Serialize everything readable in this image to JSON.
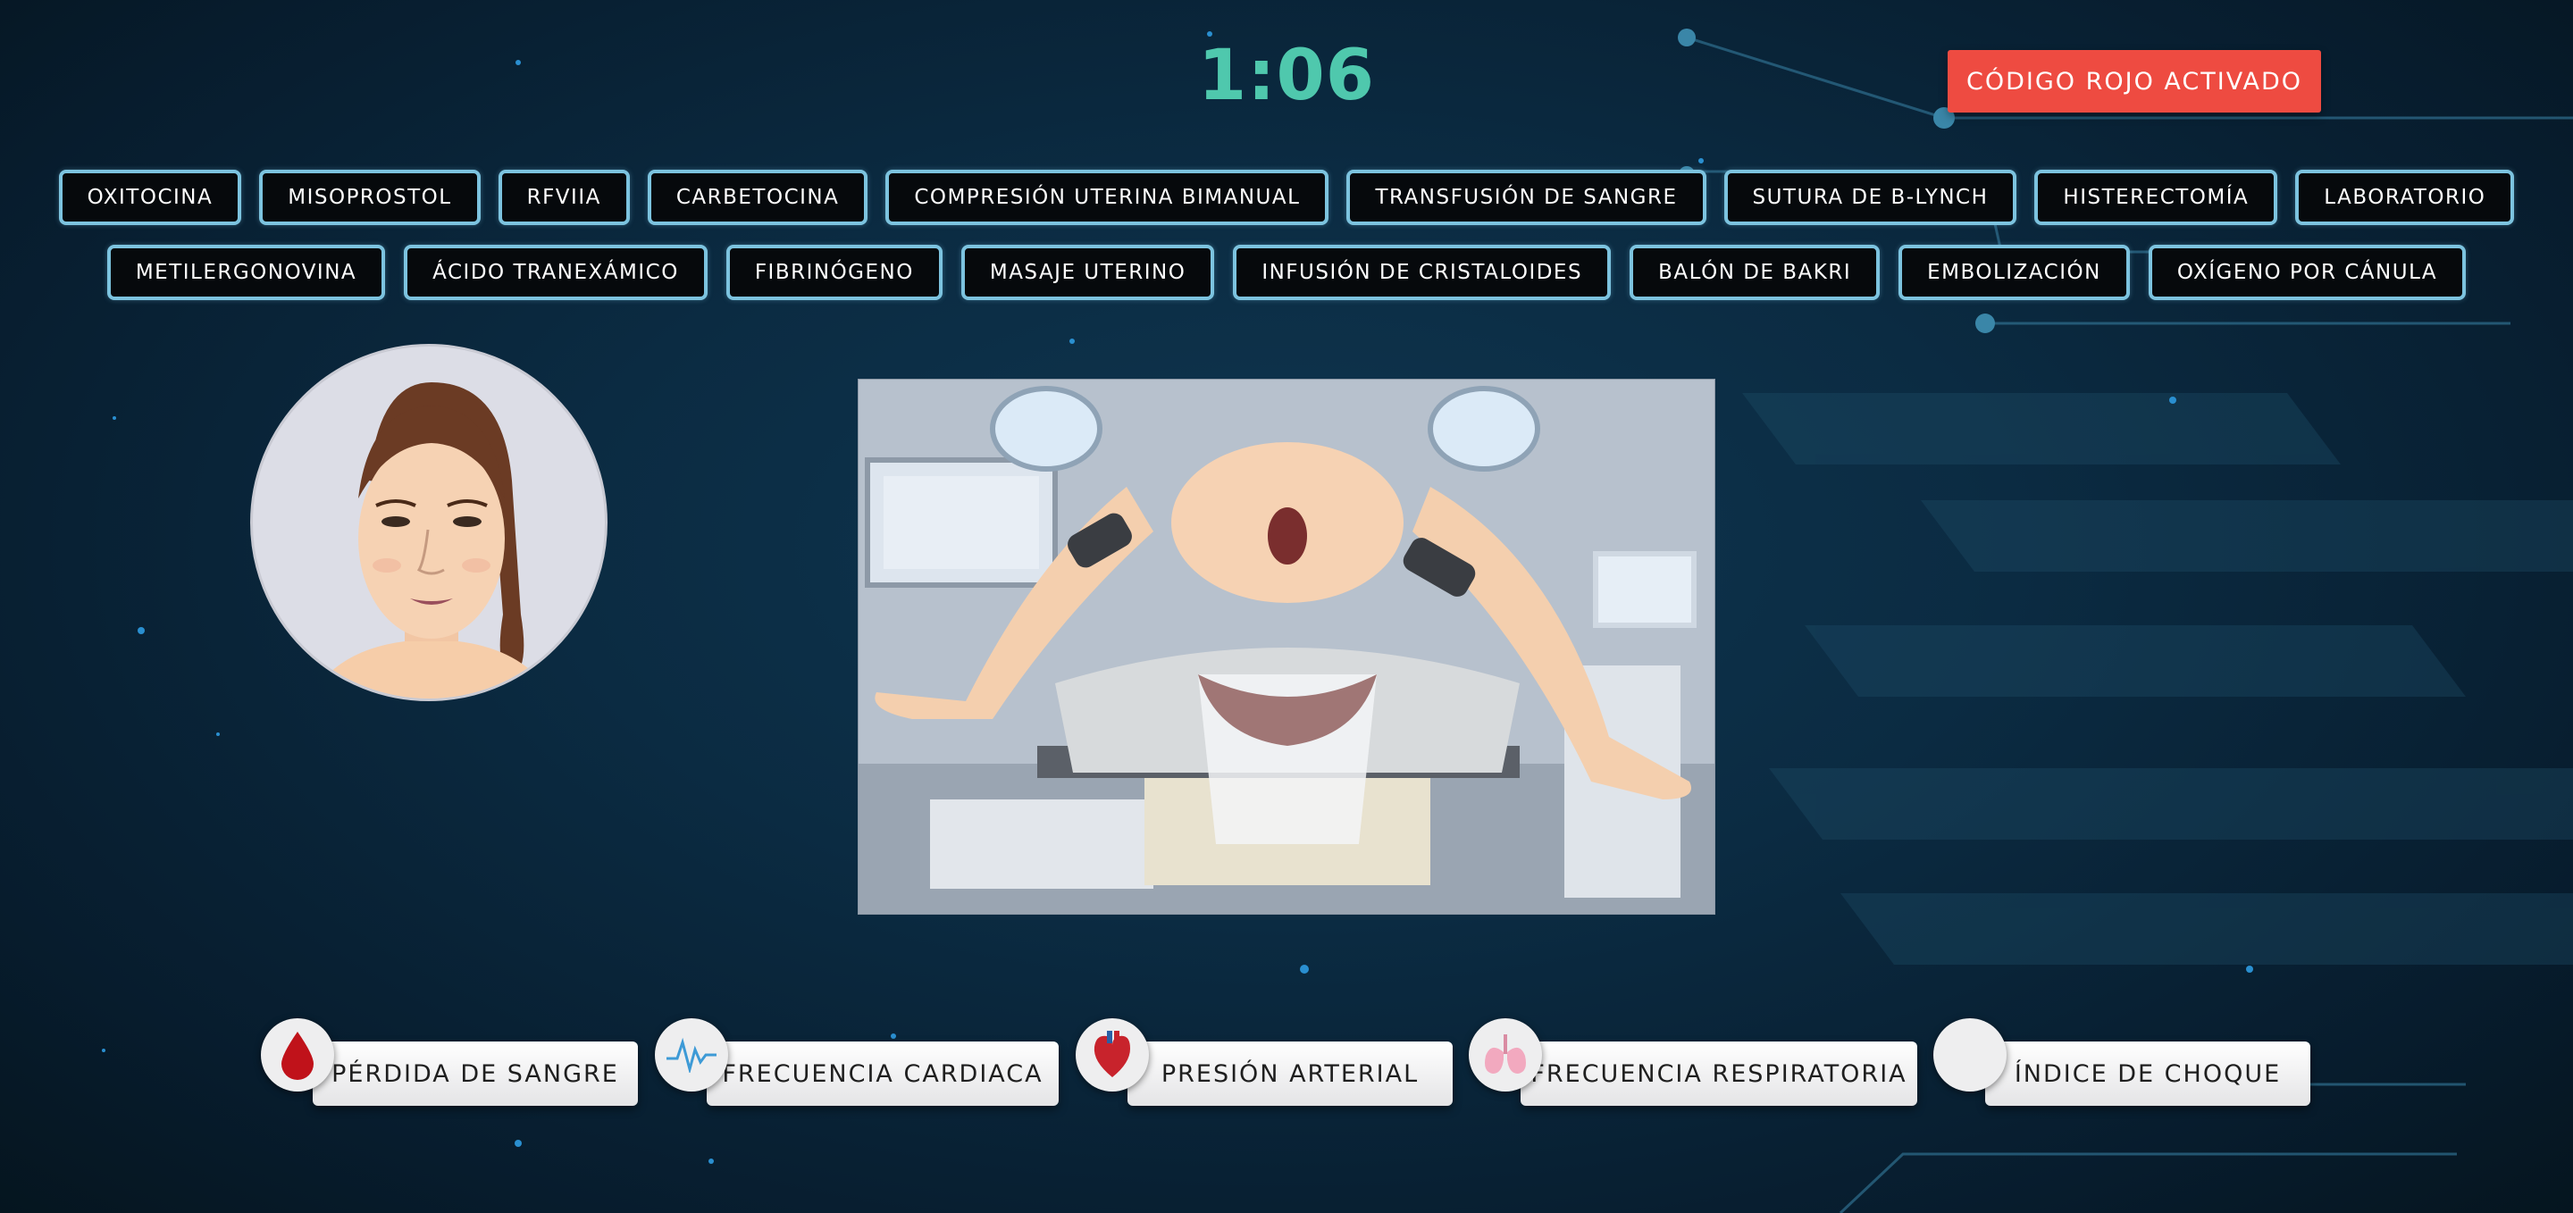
{
  "timer": {
    "value": "1:06"
  },
  "alert": {
    "label": "CÓDIGO ROJO ACTIVADO",
    "color": "#ee4b41"
  },
  "actions": {
    "row1": [
      "OXITOCINA",
      "MISOPROSTOL",
      "RFVIIA",
      "CARBETOCINA",
      "COMPRESIÓN UTERINA BIMANUAL",
      "TRANSFUSIÓN DE SANGRE",
      "SUTURA DE B-LYNCH",
      "HISTERECTOMÍA",
      "LABORATORIO"
    ],
    "row2": [
      "METILERGONOVINA",
      "ÁCIDO TRANEXÁMICO",
      "FIBRINÓGENO",
      "MASAJE UTERINO",
      "INFUSIÓN DE CRISTALOIDES",
      "BALÓN DE BAKRI",
      "EMBOLIZACIÓN",
      "OXÍGENO POR CÁNULA"
    ]
  },
  "patient": {
    "avatar_icon": "patient-face-icon"
  },
  "scene": {
    "illustration": "delivery-room-scene"
  },
  "indicators": [
    {
      "label": "PÉRDIDA DE SANGRE",
      "icon": "blood-drop-icon"
    },
    {
      "label": "FRECUENCIA CARDIACA",
      "icon": "heartbeat-icon"
    },
    {
      "label": "PRESIÓN ARTERIAL",
      "icon": "heart-icon"
    },
    {
      "label": "FRECUENCIA RESPIRATORIA",
      "icon": "lungs-icon"
    },
    {
      "label": "ÍNDICE DE CHOQUE",
      "icon": "blank-circle-icon"
    }
  ],
  "colors": {
    "timer": "#4fc8ad",
    "button_border": "#7cc3df",
    "background": "#0b2b42"
  }
}
